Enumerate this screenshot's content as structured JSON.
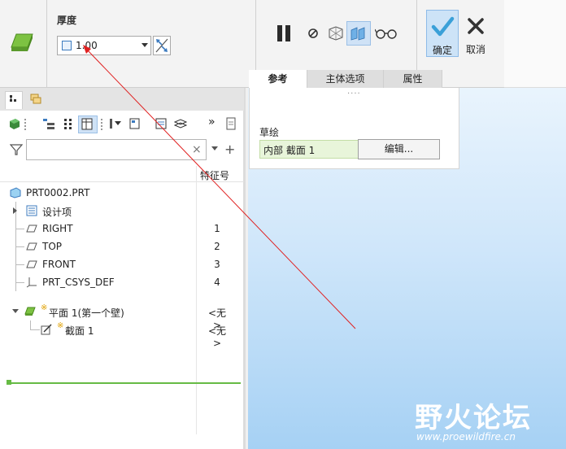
{
  "ribbon": {
    "thickness_label": "厚度",
    "thickness_value": "1.00",
    "ok_label": "确定",
    "cancel_label": "取消"
  },
  "tabs": [
    {
      "label": "参考",
      "active": true
    },
    {
      "label": "主体选项",
      "active": false
    },
    {
      "label": "属性",
      "active": false
    }
  ],
  "ref_panel": {
    "dots": "····",
    "sketch_label": "草绘",
    "sketch_value": "内部 截面 1",
    "edit_button": "编辑..."
  },
  "model_tree": {
    "filter_placeholder": "",
    "column_header": "特征号",
    "root": "PRT0002.PRT",
    "items": [
      {
        "label": "设计项",
        "num": ""
      },
      {
        "label": "RIGHT",
        "num": "1"
      },
      {
        "label": "TOP",
        "num": "2"
      },
      {
        "label": "FRONT",
        "num": "3"
      },
      {
        "label": "PRT_CSYS_DEF",
        "num": "4"
      }
    ],
    "feature": {
      "marker": "※",
      "label": "平面 1(第一个壁)",
      "num": "<无>"
    },
    "child": {
      "marker": "※",
      "label": "截面 1",
      "num": "<无>"
    }
  },
  "watermark": {
    "logo": "野火论坛",
    "url": "www.proewildfire.cn"
  },
  "colors": {
    "accent": "#3c7bbf",
    "ok_check": "#3aa0d8",
    "insert_line": "#66bb44",
    "arrow": "#e02020"
  }
}
